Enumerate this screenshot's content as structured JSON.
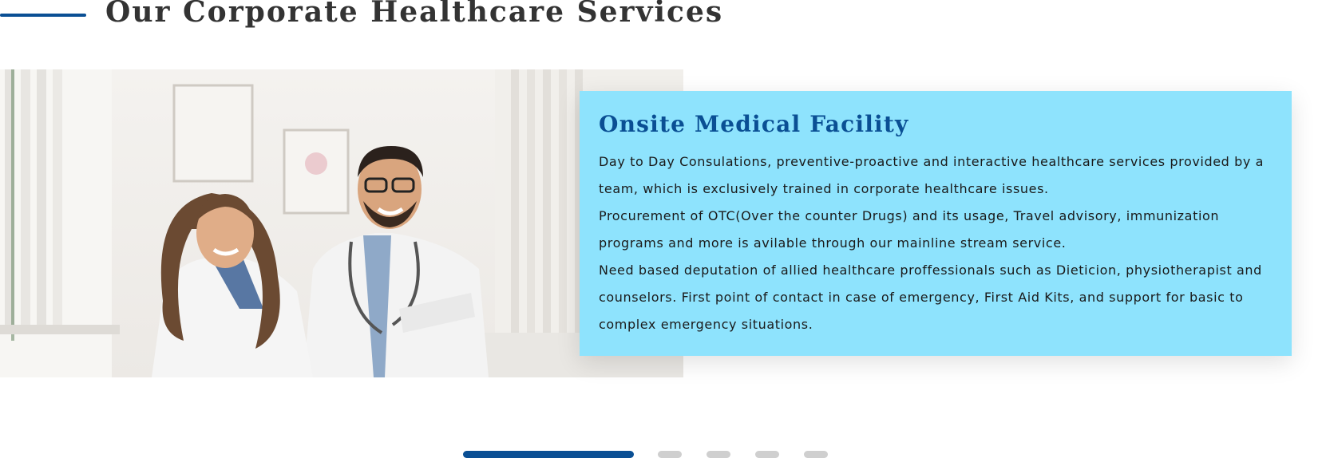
{
  "section": {
    "title": "Our Corporate Healthcare Services"
  },
  "slide": {
    "image_description": "Two smiling doctors in white coats in a clinic",
    "card_title": "Onsite Medical Facility",
    "paragraphs": [
      "Day to Day Consulations, preventive-proactive and interactive healthcare services provided by a team, which is exclusively trained in corporate healthcare issues.",
      "Procurement of OTC(Over the counter Drugs) and its usage, Travel advisory, immunization programs and more is avilable through our mainline stream service.",
      "Need based deputation of allied healthcare proffessionals such as Dieticion, physiotherapist and counselors. First point of contact in case of emergency, First Aid Kits, and support for basic to complex emergency situations."
    ]
  },
  "carousel": {
    "total_slides": 5,
    "active_index": 0
  },
  "colors": {
    "accent": "#0a4f94",
    "card_background": "#8ee3fd",
    "inactive_dot": "#cfcfcf"
  }
}
